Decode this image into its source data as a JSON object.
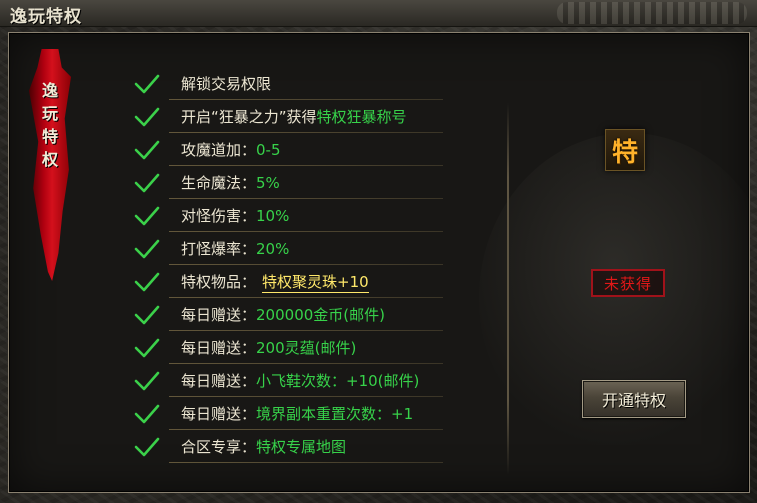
{
  "window": {
    "title": "逸玩特权"
  },
  "banner": {
    "text": "逸玩特权"
  },
  "privileges": [
    {
      "label": "解锁交易权限",
      "value": ""
    },
    {
      "label": "开启“狂暴之力”获得",
      "value": "特权狂暴称号"
    },
    {
      "label": "攻魔道加：",
      "value": "0-5"
    },
    {
      "label": "生命魔法：",
      "value": "5%"
    },
    {
      "label": "对怪伤害：",
      "value": "10%"
    },
    {
      "label": "打怪爆率：",
      "value": "20%"
    },
    {
      "label": "特权物品：",
      "value": "特权聚灵珠+10"
    },
    {
      "label": "每日赠送：",
      "value": "200000金币(邮件)"
    },
    {
      "label": "每日赠送：",
      "value": "200灵蕴(邮件)"
    },
    {
      "label": "每日赠送：",
      "value": "小飞鞋次数：+10(邮件)"
    },
    {
      "label": "每日赠送：",
      "value": "境界副本重置次数：+1"
    },
    {
      "label": "合区专享：",
      "value": "特权专属地图"
    }
  ],
  "side": {
    "badge": "特",
    "status": "未获得",
    "button": "开通特权"
  },
  "colors": {
    "label": "#ece6d2",
    "value": "#37d24a",
    "item": "#ffe86a",
    "status": "#e01818",
    "badge": "#ffb22a",
    "check": "#3bd14a"
  }
}
